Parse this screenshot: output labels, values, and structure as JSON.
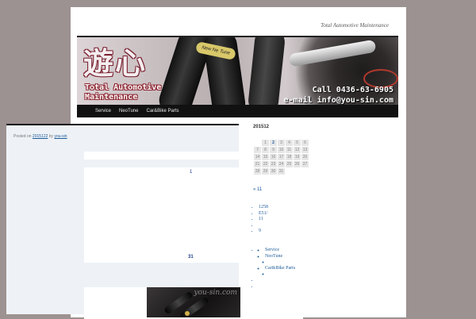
{
  "site": {
    "tagline": "Total Automotive Maintenance",
    "logo_text": "遊心",
    "banner_name_line1": "Total Automotive",
    "banner_name_line2": "Maintenance",
    "banner_phone": "Call  0436-63-6905",
    "banner_email": "e-mail  info@you-sin.com",
    "banner_product": "New Ne Tune"
  },
  "menu": {
    "items": [
      {
        "label": "Service"
      },
      {
        "label": "NeoTune"
      },
      {
        "label": "Car&Bike Parts"
      }
    ]
  },
  "post": {
    "posted_on": "Posted on",
    "date_link": "2015122",
    "by": "by",
    "author_link": "you-sin",
    "day_top": "1",
    "day_bottom": "31",
    "image_watermark": "you-sin.com"
  },
  "sidebar": {
    "calendar": {
      "caption": "201512",
      "prev": "« 11",
      "rows": [
        [
          "",
          "1",
          "2",
          "3",
          "4",
          "5",
          "6"
        ],
        [
          "7",
          "8",
          "9",
          "10",
          "11",
          "12",
          "13"
        ],
        [
          "14",
          "15",
          "16",
          "17",
          "18",
          "19",
          "20"
        ],
        [
          "21",
          "22",
          "23",
          "24",
          "25",
          "26",
          "27"
        ],
        [
          "28",
          "29",
          "30",
          "31",
          "",
          "",
          ""
        ]
      ]
    },
    "list1": [
      "1258",
      "E51/",
      "11",
      "",
      "9"
    ],
    "list2_top": "",
    "list2_items": [
      "Service",
      "NeoTune",
      "Car&Bike Parts"
    ],
    "list2_tail": [
      "",
      ""
    ]
  },
  "colors": {
    "background": "#9c9291",
    "link": "#1b5a9a",
    "menu_bar": "#111111",
    "content_bg": "#eef2f6"
  }
}
